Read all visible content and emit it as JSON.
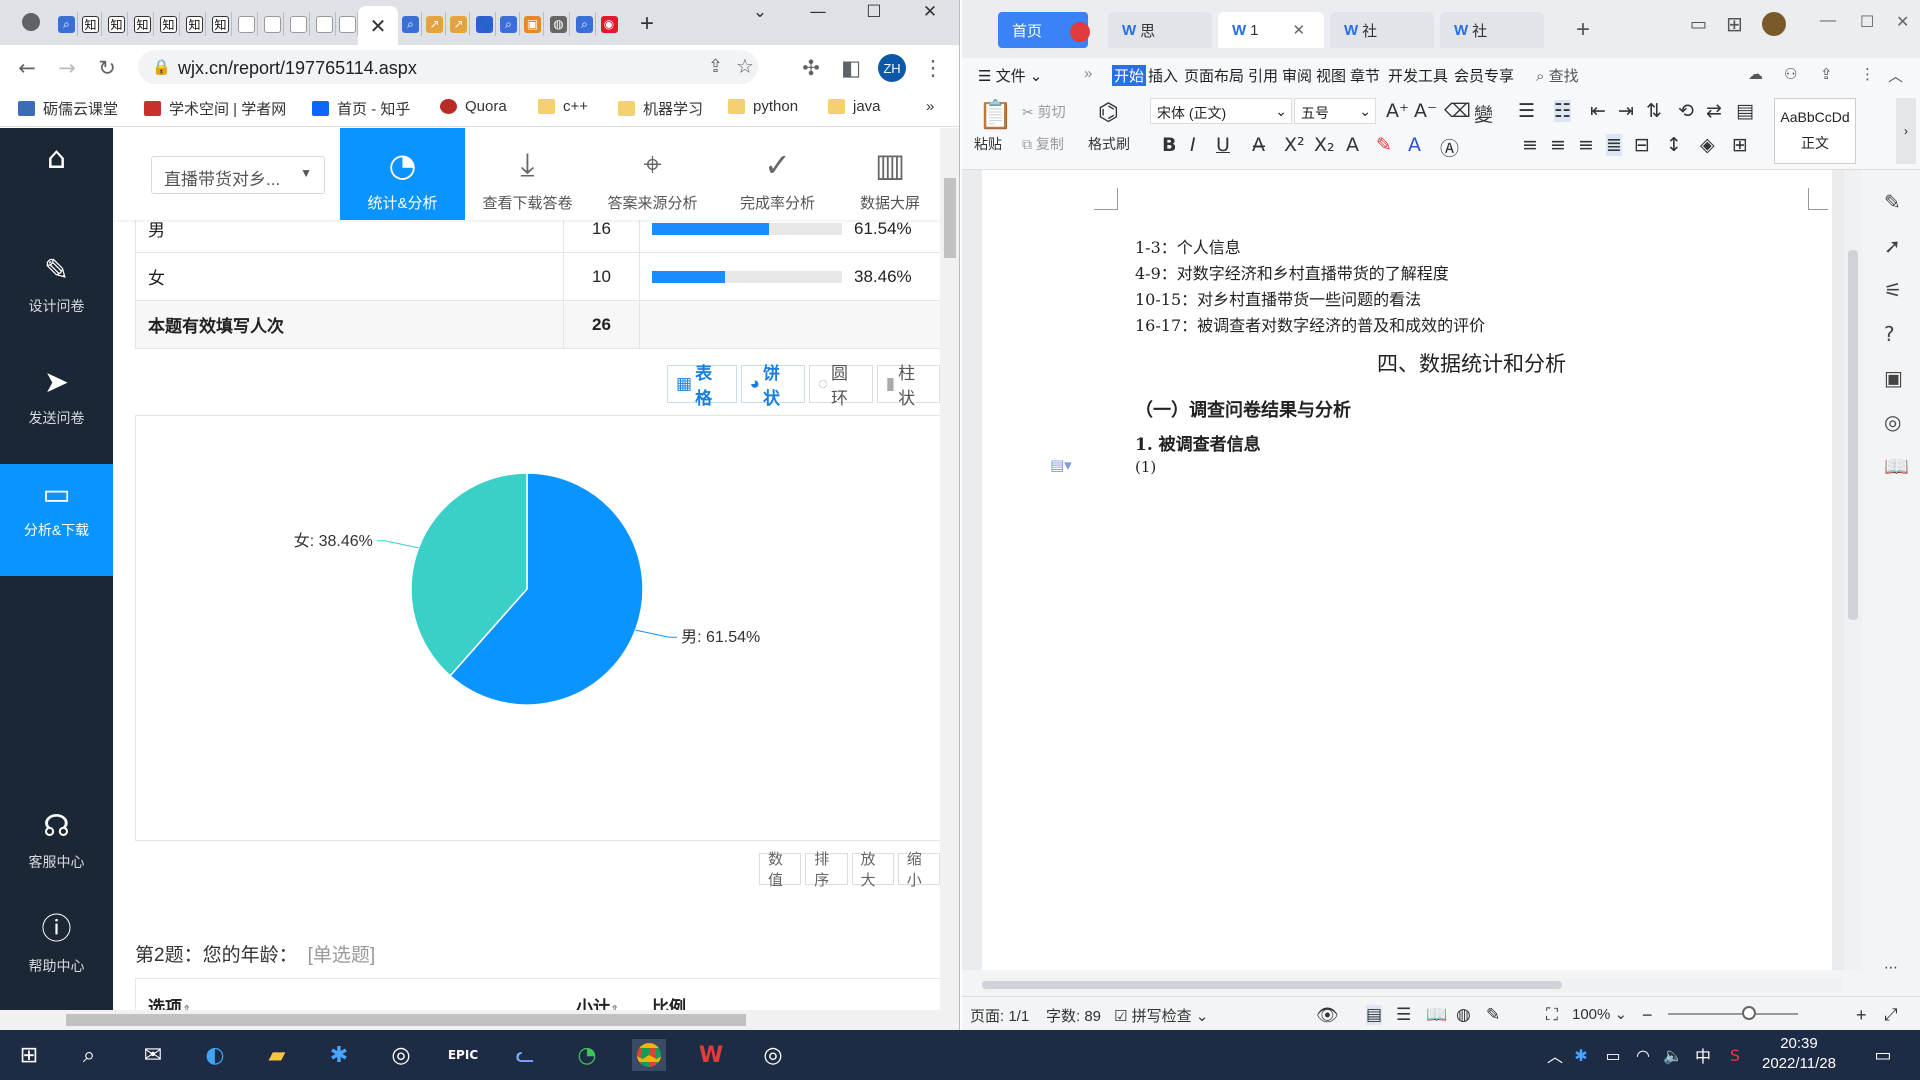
{
  "chrome": {
    "url": "wjx.cn/report/197765114.aspx",
    "profile": "ZH",
    "mini_tabs": [
      "知",
      "知",
      "知",
      "知",
      "知",
      "知"
    ],
    "bookmarks": [
      "砺儒云课堂",
      "学术空间 | 学者网",
      "首页 - 知乎",
      "Quora",
      "c++",
      "机器学习",
      "python",
      "java"
    ],
    "bookmarks_more": "»"
  },
  "survey": {
    "selector": "直播带货对乡...",
    "leftnav": [
      {
        "label": ""
      },
      {
        "label": "设计问卷"
      },
      {
        "label": "发送问卷"
      },
      {
        "label": "分析&下载"
      },
      {
        "label": "客服中心"
      },
      {
        "label": "帮助中心"
      }
    ],
    "topbtns": [
      "统计&分析",
      "查看下载答卷",
      "答案来源分析",
      "完成率分析",
      "数据大屏"
    ],
    "q1_rows": [
      {
        "option": "男",
        "count": "16",
        "percent": "61.54%",
        "fraction": 0.6154
      },
      {
        "option": "女",
        "count": "10",
        "percent": "38.46%",
        "fraction": 0.3846
      }
    ],
    "q1_total_label": "本题有效填写人次",
    "q1_total": "26",
    "view_tabs": [
      "表格",
      "饼状",
      "圆环",
      "柱状"
    ],
    "chart_controls": [
      "数值",
      "排序",
      "放大",
      "缩小"
    ],
    "q2_title": "第2题：您的年龄：",
    "q2_type": "[单选题]",
    "q2_cols": [
      "选项",
      "小计",
      "比例"
    ]
  },
  "chart_data": {
    "type": "pie",
    "categories": [
      "男",
      "女"
    ],
    "values": [
      61.54,
      38.46
    ],
    "labels": [
      "男: 61.54%",
      "女: 38.46%"
    ],
    "colors": [
      "#0a94ff",
      "#3ad0c8"
    ],
    "title": ""
  },
  "wps": {
    "tabs": [
      "首页",
      "思",
      "1",
      "社",
      "社"
    ],
    "menu": [
      "文件",
      "开始",
      "插入",
      "页面布局",
      "引用",
      "审阅",
      "视图",
      "章节",
      "开发工具",
      "会员专享",
      "查找"
    ],
    "ribbon": {
      "paste": "粘贴",
      "cut": "剪切",
      "copy": "复制",
      "format_painter": "格式刷",
      "font": "宋体 (正文)",
      "size": "五号",
      "style_sample": "AaBbCcDd",
      "style_name": "正文"
    },
    "doc": {
      "lines": [
        "1-3：个人信息",
        "4-9：对数字经济和乡村直播带货的了解程度",
        "10-15：对乡村直播带货一些问题的看法",
        "16-17：被调查者对数字经济的普及和成效的评价"
      ],
      "heading": "四、数据统计和分析",
      "subheading": "（一）调查问卷结果与分析",
      "sub2": "1. 被调查者信息",
      "item": "(1)"
    },
    "status": {
      "page": "页面: 1/1",
      "words": "字数: 89",
      "spell": "拼写检查",
      "zoom": "100%"
    }
  },
  "taskbar": {
    "time": "20:39",
    "date": "2022/11/28",
    "ime": "中"
  }
}
